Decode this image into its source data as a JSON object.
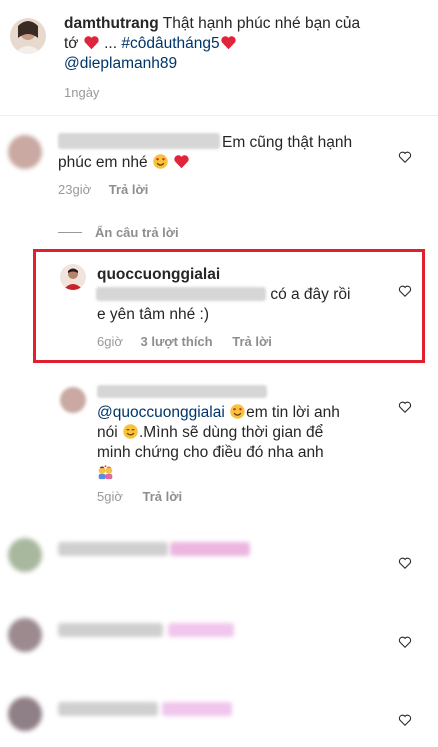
{
  "post": {
    "username": "damthutrang",
    "caption_text": "Thật hạnh phúc nhé bạn của tớ",
    "caption_ellipsis": "...",
    "hashtag": "#côdâutháng5",
    "mention": "@dieplamanh89",
    "time": "1ngày"
  },
  "comments": [
    {
      "text_line1": "Em cũng thật hạnh",
      "text_line2": "phúc em nhé",
      "time": "23giờ",
      "reply_label": "Trả lời"
    }
  ],
  "hide_replies_label": "Ẩn câu trả lời",
  "highlighted_reply": {
    "username": "quoccuonggialai",
    "text_line1": "có a đây rồi",
    "text_line2": "e yên tâm nhé :)",
    "time": "6giờ",
    "likes": "3 lượt thích",
    "reply_label": "Trả lời"
  },
  "reply2": {
    "mention": "@quoccuonggialai",
    "text_line1": "em tin lời anh",
    "text_line2_a": "nói",
    "text_line2_b": ".Mình sẽ dùng thời gian để",
    "text_line3": "minh chứng cho điều đó nha anh",
    "time": "5giờ",
    "reply_label": "Trả lời"
  },
  "colors": {
    "highlight_border": "#e0202e",
    "mention": "#003569",
    "meta_text": "#999999",
    "heart_red": "#e0243b"
  }
}
